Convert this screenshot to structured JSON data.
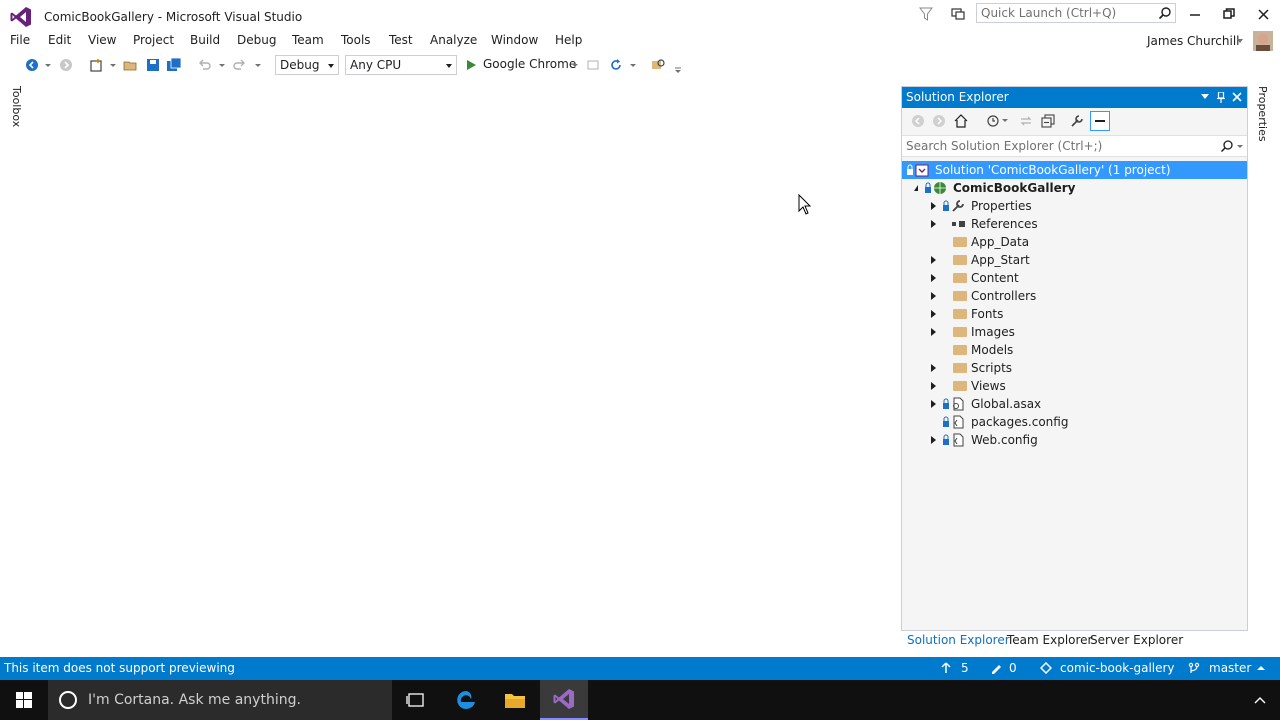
{
  "window": {
    "title": "ComicBookGallery - Microsoft Visual Studio",
    "quick_launch_placeholder": "Quick Launch (Ctrl+Q)"
  },
  "menu": {
    "items": [
      "File",
      "Edit",
      "View",
      "Project",
      "Build",
      "Debug",
      "Team",
      "Tools",
      "Test",
      "Analyze",
      "Window",
      "Help"
    ]
  },
  "user": {
    "name": "James Churchill"
  },
  "toolbar": {
    "configuration": "Debug",
    "platform": "Any CPU",
    "run_target": "Google Chrome"
  },
  "side_tabs": {
    "left": "Toolbox",
    "right": "Properties"
  },
  "solution_explorer": {
    "title": "Solution Explorer",
    "search_placeholder": "Search Solution Explorer (Ctrl+;)",
    "solution_label": "Solution 'ComicBookGallery' (1 project)",
    "project_label": "ComicBookGallery",
    "items": [
      {
        "label": "Properties",
        "expandable": true,
        "icon": "wrench-icon"
      },
      {
        "label": "References",
        "expandable": true,
        "icon": "references-icon"
      },
      {
        "label": "App_Data",
        "expandable": false,
        "icon": "folder-icon"
      },
      {
        "label": "App_Start",
        "expandable": true,
        "icon": "folder-icon"
      },
      {
        "label": "Content",
        "expandable": true,
        "icon": "folder-icon"
      },
      {
        "label": "Controllers",
        "expandable": true,
        "icon": "folder-icon"
      },
      {
        "label": "Fonts",
        "expandable": true,
        "icon": "folder-icon"
      },
      {
        "label": "Images",
        "expandable": true,
        "icon": "folder-icon"
      },
      {
        "label": "Models",
        "expandable": false,
        "icon": "folder-icon"
      },
      {
        "label": "Scripts",
        "expandable": true,
        "icon": "folder-icon"
      },
      {
        "label": "Views",
        "expandable": true,
        "icon": "folder-icon"
      },
      {
        "label": "Global.asax",
        "expandable": true,
        "icon": "file-icon"
      },
      {
        "label": "packages.config",
        "expandable": false,
        "icon": "config-file-icon"
      },
      {
        "label": "Web.config",
        "expandable": true,
        "icon": "config-file-icon"
      }
    ],
    "bottom_tabs": [
      "Solution Explorer",
      "Team Explorer",
      "Server Explorer"
    ]
  },
  "status_bar": {
    "message": "This item does not support previewing",
    "pushes": "5",
    "changes": "0",
    "repository": "comic-book-gallery",
    "branch": "master"
  },
  "taskbar": {
    "cortana_placeholder": "I'm Cortana. Ask me anything."
  },
  "colors": {
    "accent": "#007acc",
    "selection": "#3399ff",
    "vs_purple": "#68217a"
  }
}
